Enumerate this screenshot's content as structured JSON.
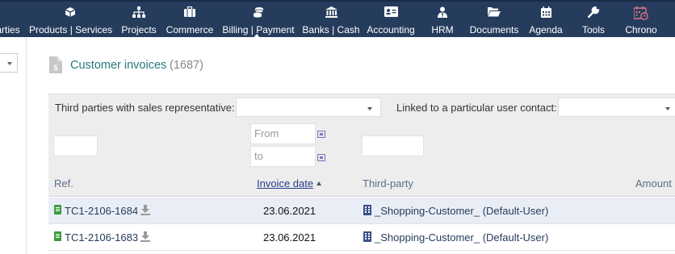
{
  "nav": {
    "items": [
      {
        "label": "arties",
        "icon": "third-parties-icon"
      },
      {
        "label": "Products | Services",
        "icon": "cube-icon"
      },
      {
        "label": "Projects",
        "icon": "sitemap-icon"
      },
      {
        "label": "Commerce",
        "icon": "suitcase-icon"
      },
      {
        "label": "Billing | Payment",
        "icon": "coins-icon"
      },
      {
        "label": "Banks | Cash",
        "icon": "bank-icon"
      },
      {
        "label": "Accounting",
        "icon": "id-card-icon"
      },
      {
        "label": "HRM",
        "icon": "user-tie-icon"
      },
      {
        "label": "Documents",
        "icon": "folder-open-icon"
      },
      {
        "label": "Agenda",
        "icon": "calendar-icon"
      },
      {
        "label": "Tools",
        "icon": "wrench-icon"
      },
      {
        "label": "Chrono",
        "icon": "calendar-clock-icon"
      }
    ]
  },
  "page": {
    "title": "Customer invoices",
    "count": "(1687)"
  },
  "filters": {
    "sales_rep_label": "Third parties with sales representative:",
    "user_contact_label": "Linked to a particular user contact:"
  },
  "search": {
    "date_from_placeholder": "From",
    "date_to_placeholder": "to"
  },
  "table": {
    "headers": {
      "ref": "Ref.",
      "invoice_date": "Invoice date",
      "third_party": "Third-party",
      "amount": "Amount"
    },
    "rows": [
      {
        "ref": "TC1-2106-1684",
        "date": "23.06.2021",
        "third_party": "_Shopping-Customer_ (Default-User)"
      },
      {
        "ref": "TC1-2106-1683",
        "date": "23.06.2021",
        "third_party": "_Shopping-Customer_ (Default-User)"
      }
    ]
  },
  "colors": {
    "topbar": "#263c5c",
    "title": "#25777a",
    "row_highlight": "#e9eef6"
  }
}
